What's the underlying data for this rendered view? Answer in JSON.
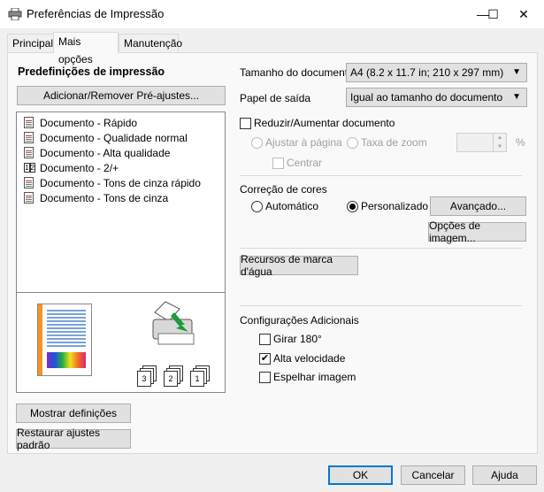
{
  "window": {
    "title": "Preferências de Impressão",
    "minimize": "—",
    "maximize": "☐",
    "close": "✕"
  },
  "tabs": [
    {
      "label": "Principal"
    },
    {
      "label": "Mais opções"
    },
    {
      "label": "Manutenção"
    }
  ],
  "left": {
    "presets_title": "Predefinições de impressão",
    "add_remove_button": "Adicionar/Remover Pré-ajustes...",
    "presets": [
      {
        "label": "Documento - Rápido"
      },
      {
        "label": "Documento - Qualidade normal"
      },
      {
        "label": "Documento - Alta qualidade"
      },
      {
        "label": "Documento - 2/+"
      },
      {
        "label": "Documento - Tons de cinza rápido"
      },
      {
        "label": "Documento - Tons de cinza"
      }
    ],
    "show_settings_button": "Mostrar definições",
    "restore_defaults_button": "Restaurar ajustes padrão"
  },
  "right": {
    "doc_size_label": "Tamanho do documento",
    "doc_size_value": "A4 (8.2 x 11.7 in; 210 x 297 mm)",
    "output_paper_label": "Papel de saída",
    "output_paper_value": "Igual ao tamanho do documento",
    "reduce_enlarge_label": "Reduzir/Aumentar documento",
    "fit_page_label": "Ajustar à página",
    "zoom_label": "Taxa de zoom",
    "zoom_value": "",
    "percent": "%",
    "center_label": "Centrar",
    "color_correction_label": "Correção de cores",
    "automatic_label": "Automático",
    "custom_label": "Personalizado",
    "advanced_button": "Avançado...",
    "image_options_button": "Opções de imagem...",
    "watermark_button": "Recursos de marca d'água",
    "additional_settings_label": "Configurações Adicionais",
    "rotate_label": "Girar 180°",
    "high_speed_label": "Alta velocidade",
    "mirror_label": "Espelhar imagem",
    "high_speed_checked": true
  },
  "footer": {
    "ok": "OK",
    "cancel": "Cancelar",
    "help": "Ajuda"
  },
  "preview": {
    "copy_numbers": [
      "3",
      "2",
      "1"
    ]
  },
  "colors": {
    "accent": "#0078d7",
    "orange": "#f7931e",
    "arrow_green": "#1c9a3c"
  }
}
